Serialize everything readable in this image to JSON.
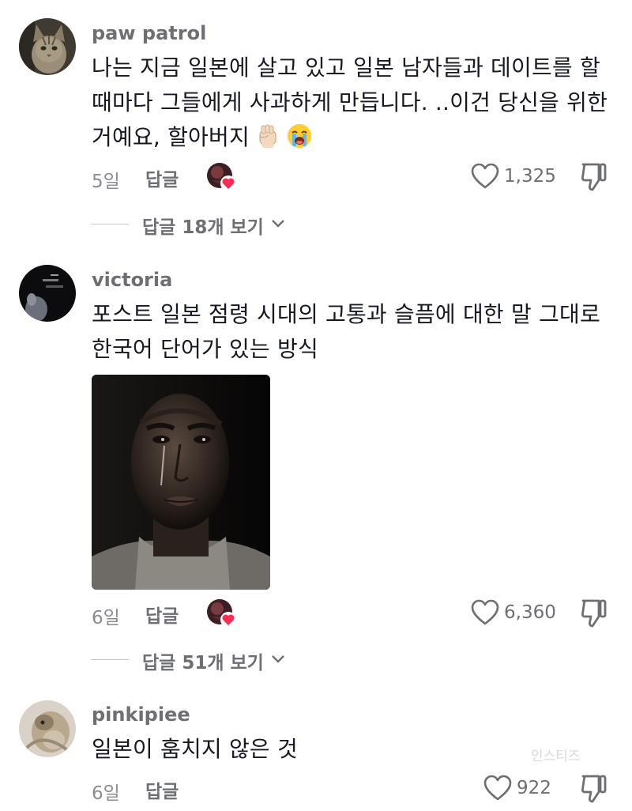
{
  "comments": [
    {
      "username": "paw patrol",
      "text_lines": [
        "나는 지금 일본에 살고 있고 일본 남자들과 데이트를 할",
        "때마다 그들에게 사과하게 만듭니다. ..이건 당신을 위한",
        "거예요, 할아버지"
      ],
      "emoji": [
        "raised-fist-emoji",
        "loudly-crying-face-emoji"
      ],
      "age": "5일",
      "reply_label": "답글",
      "creator_liked": true,
      "like_count": "1,325",
      "view_replies": "답글 18개 보기"
    },
    {
      "username": "victoria",
      "text_lines": [
        "포스트 일본 점령 시대의 고통과 슬픔에 대한 말 그대로",
        "한국어 단어가 있는 방식"
      ],
      "has_photo": true,
      "age": "6일",
      "reply_label": "답글",
      "creator_liked": true,
      "like_count": "6,360",
      "view_replies": "답글 51개 보기"
    },
    {
      "username": "pinkipiee",
      "text_lines": [
        "일본이 훔치지 않은 것"
      ],
      "age": "6일",
      "reply_label": "답글",
      "creator_liked": false,
      "like_count": "922"
    }
  ],
  "watermark": "인스티즈",
  "colors": {
    "text": "#161823",
    "secondary": "#6e6f74",
    "muted": "#8a8b91",
    "heart_badge": "#fe2c55"
  },
  "icons": [
    "heart-outline-icon",
    "thumbs-down-icon",
    "chevron-down-icon",
    "creator-like-badge"
  ]
}
